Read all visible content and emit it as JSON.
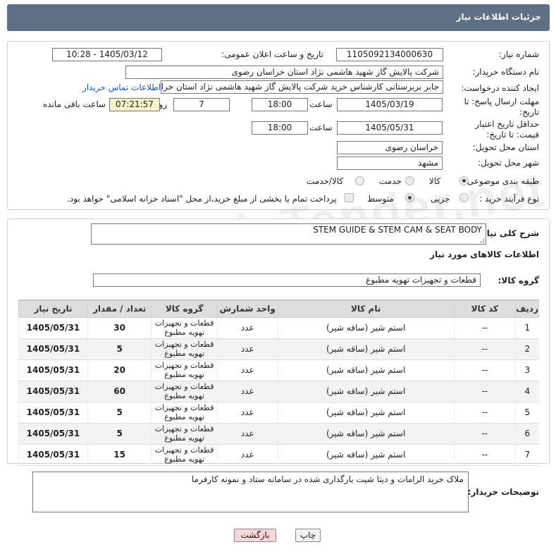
{
  "header": {
    "title": "جزئیات اطلاعات نیاز"
  },
  "form": {
    "need_number_label": "شماره نیاز:",
    "need_number": "1105092134000630",
    "announce_label": "تاریخ و ساعت اعلان عمومی:",
    "announce_value": "1405/03/12 - 10:28",
    "buyer_org_label": "نام دستگاه خریدار:",
    "buyer_org": "شرکت پالایش گاز شهید هاشمی نژاد   استان خراسان رضوی",
    "creator_label": "ایجاد کننده درخواست:",
    "creator": "جابر بربرستانی کارشناس خرید شرکت پالایش گاز شهید هاشمی نژاد   استان خراسان رضوی",
    "contact_link": "اطلاعات تماس خریدار",
    "reply_deadline_label": "مهلت ارسال پاسخ: تا تاریخ:",
    "reply_date": "1405/03/19",
    "time_label": "ساعت",
    "reply_time": "18:00",
    "days_value": "7",
    "days_label": "روز و",
    "remaining_time": "07:21:57",
    "remaining_label": "ساعت باقی مانده",
    "price_validity_label": "حداقل تاریخ اعتبار قیمت: تا تاریخ:",
    "price_date": "1405/05/31",
    "price_time": "18:00",
    "province_label": "استان محل تحویل:",
    "province": "خراسان رضوی",
    "city_label": "شهر محل تحویل:",
    "city": "مشهد",
    "category_label": "طبقه بندی موضوعی:",
    "category_options": [
      "کالا",
      "خدمت",
      "کالا/خدمت"
    ],
    "process_label": "نوع فرآیند خرید :",
    "process_options": [
      "جزیی",
      "متوسط"
    ],
    "payment_note": "پرداخت تمام یا بخشی از مبلغ خرید،از محل \"اسناد خزانه اسلامی\" خواهد بود."
  },
  "summary": {
    "label": "شرح کلی نیاز:",
    "value": "STEM GUIDE & STEM CAM & SEAT BODY",
    "goods_info_title": "اطلاعات کالاهای مورد نیاز",
    "group_label": "گروه کالا:",
    "group_value": "قطعات و تجهیزات تهویه مطبوع"
  },
  "table": {
    "headers": [
      "ردیف",
      "کد کالا",
      "نام کالا",
      "واحد شمارش",
      "گروه کالا",
      "تعداد / مقدار",
      "تاریخ نیاز"
    ],
    "rows": [
      [
        "1",
        "--",
        "استم شیر (ساقه شیر)",
        "عدد",
        "قطعات و تجهیزات تهویه مطبوع",
        "30",
        "1405/05/31"
      ],
      [
        "2",
        "--",
        "استم شیر (ساقه شیر)",
        "عدد",
        "قطعات و تجهیزات تهویه مطبوع",
        "5",
        "1405/05/31"
      ],
      [
        "3",
        "--",
        "استم شیر (ساقه شیر)",
        "عدد",
        "قطعات و تجهیزات تهویه مطبوع",
        "20",
        "1405/05/31"
      ],
      [
        "4",
        "--",
        "استم شیر (ساقه شیر)",
        "عدد",
        "قطعات و تجهیزات تهویه مطبوع",
        "60",
        "1405/05/31"
      ],
      [
        "5",
        "--",
        "استم شیر (ساقه شیر)",
        "عدد",
        "قطعات و تجهیزات تهویه مطبوع",
        "5",
        "1405/05/31"
      ],
      [
        "6",
        "--",
        "استم شیر (ساقه شیر)",
        "عدد",
        "قطعات و تجهیزات تهویه مطبوع",
        "5",
        "1405/05/31"
      ],
      [
        "7",
        "--",
        "استم شیر (ساقه شیر)",
        "عدد",
        "قطعات و تجهیزات تهویه مطبوع",
        "15",
        "1405/05/31"
      ]
    ]
  },
  "buyer_notes": {
    "label": "توضیحات خریدار:",
    "value": "ملاک خرید الزامات و دیتا شیت بارگذاری شده در سامانه ستاد و نمونه کارفرما"
  },
  "buttons": {
    "print": "چاپ",
    "back": "بازگشت"
  },
  "watermark": "AriaTender.net",
  "colors": {
    "header_bg": "#5f6f86",
    "back_button_bg": "#f6d6d6",
    "remaining_bg": "#f6f2c8"
  }
}
